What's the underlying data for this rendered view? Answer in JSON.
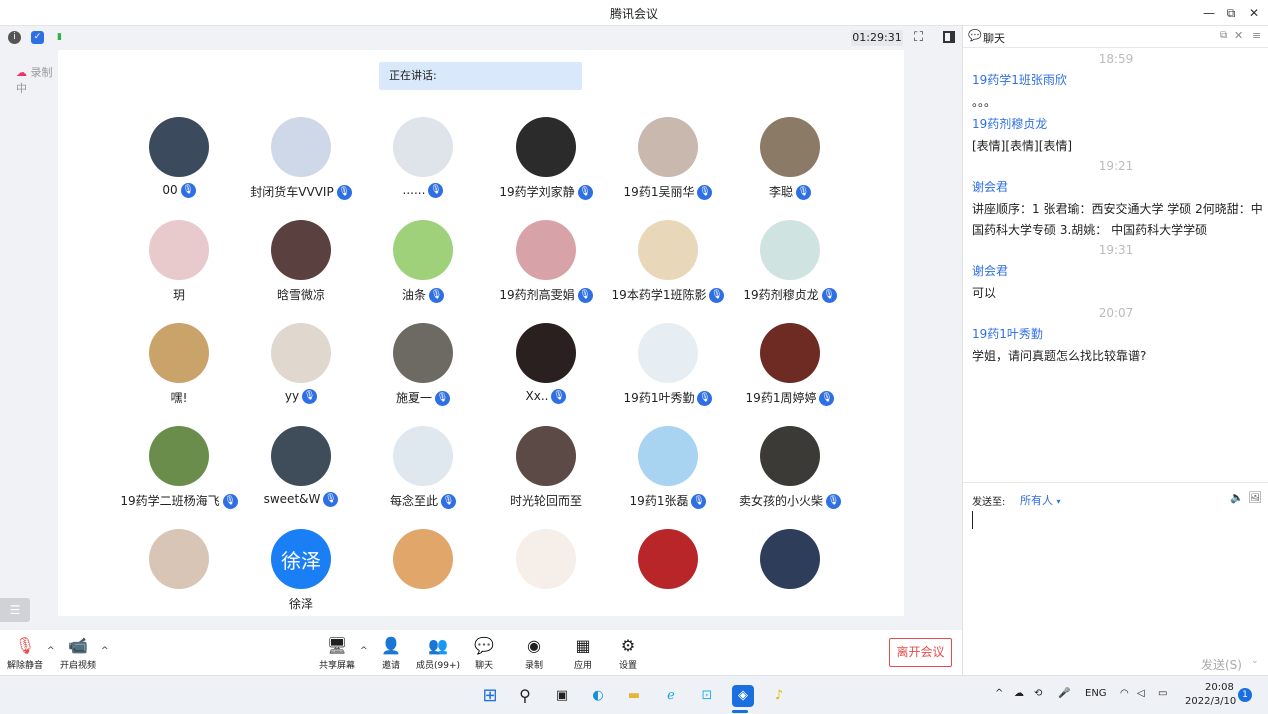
{
  "window": {
    "title": "腾讯会议",
    "minimize": "—",
    "restore": "⧉",
    "close": "✕"
  },
  "meetbar": {
    "timer": "01:29:31",
    "info_icon": "info-icon",
    "shield_icon": "shield-icon",
    "signal_icon": "signal-icon"
  },
  "left": {
    "recording": "录制中",
    "toggle": "☰"
  },
  "stage": {
    "speaking_label": "正在讲话:"
  },
  "participants": [
    {
      "name": "00",
      "mic": true,
      "bg": "#3b4a5c"
    },
    {
      "name": "封闭货车VVVIP",
      "mic": true,
      "bg": "#cfd8e8"
    },
    {
      "name": "......",
      "mic": true,
      "bg": "#dfe3ea"
    },
    {
      "name": "19药学刘家静",
      "mic": true,
      "bg": "#2b2b2b"
    },
    {
      "name": "19药1吴丽华",
      "mic": true,
      "bg": "#c9b8ad"
    },
    {
      "name": "李聪",
      "mic": true,
      "bg": "#8b7a66"
    },
    {
      "name": "玥",
      "mic": false,
      "bg": "#e8c9cc"
    },
    {
      "name": "晗雪微凉",
      "mic": false,
      "bg": "#5a4140"
    },
    {
      "name": "油条",
      "mic": true,
      "bg": "#9fd07a"
    },
    {
      "name": "19药剂高雯娟",
      "mic": true,
      "bg": "#d8a3a8"
    },
    {
      "name": "19本药学1班陈影",
      "mic": true,
      "bg": "#e9d7b9"
    },
    {
      "name": "19药剂穆贞龙",
      "mic": true,
      "bg": "#cfe3e0"
    },
    {
      "name": "嘿!",
      "mic": false,
      "bg": "#caa36b"
    },
    {
      "name": "yy",
      "mic": true,
      "bg": "#e0d7cf"
    },
    {
      "name": "施夏一",
      "mic": true,
      "bg": "#6d6a63"
    },
    {
      "name": "Xx..",
      "mic": true,
      "bg": "#2a2020"
    },
    {
      "name": "19药1叶秀勤",
      "mic": true,
      "bg": "#e6edf3"
    },
    {
      "name": "19药1周婷婷",
      "mic": true,
      "bg": "#6e2b24"
    },
    {
      "name": "19药学二班杨海飞",
      "mic": true,
      "bg": "#6b8d4c"
    },
    {
      "name": "sweet&W",
      "mic": true,
      "bg": "#3f4d5a"
    },
    {
      "name": "每念至此",
      "mic": true,
      "bg": "#dfe8ef"
    },
    {
      "name": "时光轮回而至",
      "mic": false,
      "bg": "#5b4a45"
    },
    {
      "name": "19药1张磊",
      "mic": true,
      "bg": "#a8d4f2"
    },
    {
      "name": "卖女孩的小火柴",
      "mic": true,
      "bg": "#3c3a36"
    },
    {
      "name": "",
      "mic": false,
      "bg": "#d8c5b6"
    },
    {
      "name": "徐泽",
      "mic": false,
      "bg": "#1a7ef5",
      "text": "徐泽"
    },
    {
      "name": "",
      "mic": false,
      "bg": "#e0a66a"
    },
    {
      "name": "",
      "mic": false,
      "bg": "#f6eee8"
    },
    {
      "name": "",
      "mic": false,
      "bg": "#b8262a"
    },
    {
      "name": "",
      "mic": false,
      "bg": "#2e3e5a"
    }
  ],
  "toolbar": {
    "unmute": "解除静音",
    "video": "开启视频",
    "share": "共享屏幕",
    "invite": "邀请",
    "members": "成员(99+)",
    "chat": "聊天",
    "record": "录制",
    "apps": "应用",
    "settings": "设置",
    "leave": "离开会议"
  },
  "chat": {
    "title": "聊天",
    "messages": [
      {
        "type": "time",
        "text": "18:59"
      },
      {
        "type": "sender",
        "text": "19药学1班张雨欣"
      },
      {
        "type": "text",
        "text": "。。。"
      },
      {
        "type": "sender",
        "text": "19药剂穆贞龙"
      },
      {
        "type": "text",
        "text": "[表情][表情][表情]"
      },
      {
        "type": "time",
        "text": "19:21"
      },
      {
        "type": "sender",
        "text": "谢会君"
      },
      {
        "type": "text",
        "text": "讲座顺序：1 张君瑜：西安交通大学 学硕  2何晓甜：中"
      },
      {
        "type": "text",
        "text": "国药科大学专硕 3.胡姚： 中国药科大学学硕"
      },
      {
        "type": "time",
        "text": "19:31"
      },
      {
        "type": "sender",
        "text": "谢会君"
      },
      {
        "type": "text",
        "text": "可以"
      },
      {
        "type": "time",
        "text": "20:07"
      },
      {
        "type": "sender",
        "text": "19药1叶秀勤"
      },
      {
        "type": "text",
        "text": "学姐，请问真题怎么找比较靠谱?"
      }
    ],
    "send_to_label": "发送至:",
    "send_to_value": "所有人",
    "send_button": "发送(S)"
  },
  "taskbar": {
    "lang": "ENG",
    "time": "20:08",
    "date": "2022/3/10",
    "notif": "1"
  }
}
